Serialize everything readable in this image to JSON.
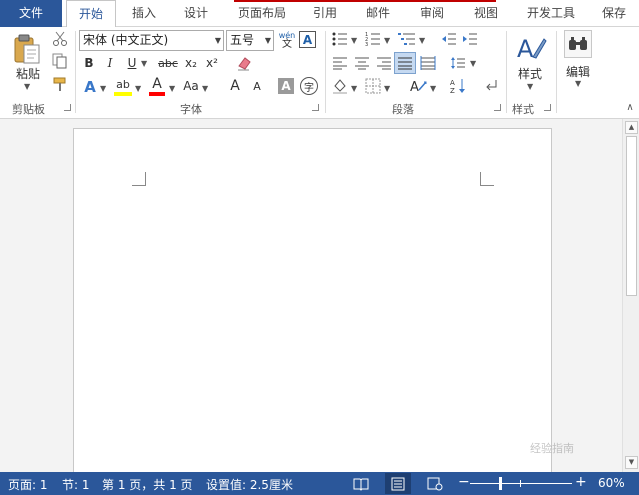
{
  "tabs": [
    {
      "label": "文件"
    },
    {
      "label": "开始"
    },
    {
      "label": "插入"
    },
    {
      "label": "设计"
    },
    {
      "label": "页面布局"
    },
    {
      "label": "引用"
    },
    {
      "label": "邮件"
    },
    {
      "label": "审阅"
    },
    {
      "label": "视图"
    },
    {
      "label": "开发工具"
    },
    {
      "label": "保存"
    }
  ],
  "active_tab": "开始",
  "clipboard": {
    "paste_label": "粘贴",
    "group_label": "剪贴板"
  },
  "font": {
    "font_name": "宋体 (中文正文)",
    "font_size": "五号",
    "group_label": "字体",
    "phonetic_top": "wén",
    "phonetic_bottom": "文",
    "border_char": "A",
    "bold": "B",
    "italic": "I",
    "underline": "U",
    "strikethrough": "abc",
    "subscript": "x₂",
    "superscript": "x²",
    "text_effects": "A",
    "highlight": "ab",
    "font_color": "A",
    "change_case": "Aa",
    "grow_font": "A",
    "shrink_font": "A",
    "char_shading": "A",
    "enclosed_char": "字"
  },
  "paragraph": {
    "group_label": "段落"
  },
  "styles": {
    "label": "样式",
    "group_label": "样式"
  },
  "editing": {
    "label": "编辑"
  },
  "status": {
    "page": "页面: 1",
    "section": "节: 1",
    "page_of": "第 1 页，共 1 页",
    "setting": "设置值: 2.5厘米",
    "zoom_minus": "−",
    "zoom_plus": "+",
    "zoom": "60%"
  },
  "watermark": "经验指南",
  "colors": {
    "accent": "#2b579a",
    "highlight_bar": "#ffff00",
    "font_color_bar": "#ff0000",
    "title_red_line": "#c00000"
  }
}
